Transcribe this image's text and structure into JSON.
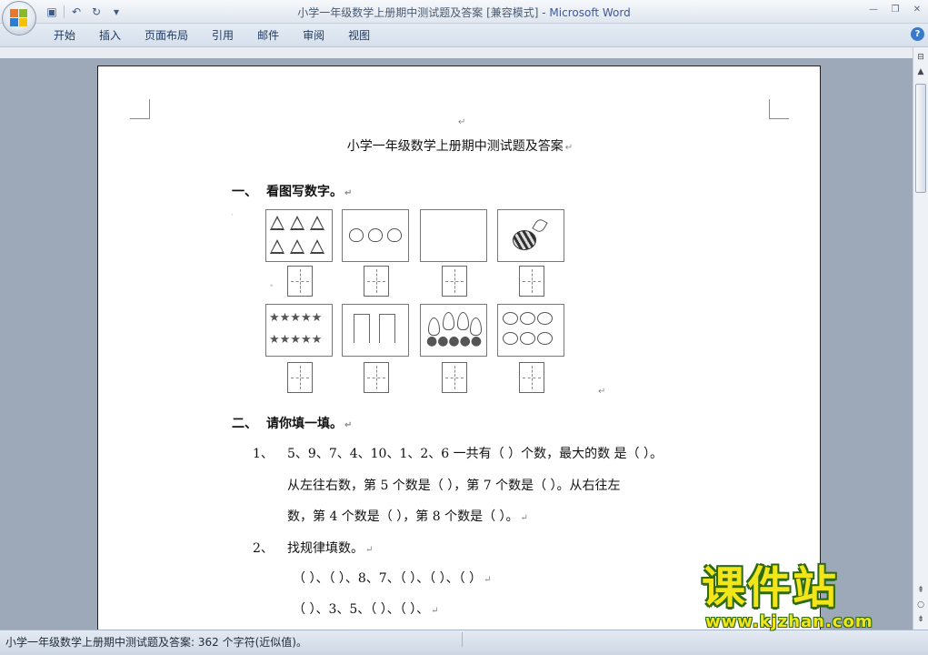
{
  "window": {
    "title": "小学一年级数学上册期中测试题及答案 [兼容模式] - ",
    "app_name": "Microsoft Word"
  },
  "ribbon": {
    "tabs": [
      "开始",
      "插入",
      "页面布局",
      "引用",
      "邮件",
      "审阅",
      "视图"
    ]
  },
  "document": {
    "heading": "小学一年级数学上册期中测试题及答案",
    "section1": {
      "num": "一、",
      "title": "看图写数字。"
    },
    "section2": {
      "num": "二、",
      "title": "请你填一填。"
    },
    "q1": {
      "num": "1、",
      "line1": "5、9、7、4、10、1、2、6 一共有（    ）个数，最大的数 是（  ）。",
      "line2": "从左往右数，第 5 个数是（    ），第 7 个数是（    ）。从右往左",
      "line3": "数，第 4 个数是（    ），第 8 个数是（    ）。"
    },
    "q2": {
      "num": "2、",
      "title": "找规律填数。",
      "line1": "（  ）、（  ）、8、7、（  ）、（    ）、（    ）",
      "line2": "（  ）、3、5、（  ）、（  ）、"
    },
    "para_mark": "↵"
  },
  "status": {
    "text": "小学一年级数学上册期中测试题及答案: 362 个字符(近似值)。"
  },
  "watermark": {
    "title": "课件站",
    "url": "www.kjzhan.com"
  }
}
